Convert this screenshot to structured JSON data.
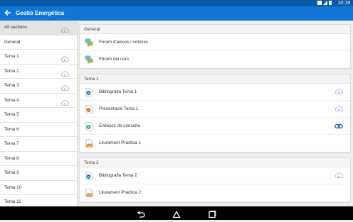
{
  "status": {
    "time": "10:19"
  },
  "header": {
    "title": "Gestió Energètica"
  },
  "sidebar": {
    "items": [
      {
        "label": "All sections",
        "cloud": true,
        "active": true
      },
      {
        "label": "General",
        "cloud": false
      },
      {
        "label": "Tema 1",
        "cloud": true
      },
      {
        "label": "Tema 2",
        "cloud": true
      },
      {
        "label": "Tema 3",
        "cloud": true
      },
      {
        "label": "Tema 4",
        "cloud": true
      },
      {
        "label": "Tema 5",
        "cloud": false
      },
      {
        "label": "Tema 6",
        "cloud": false
      },
      {
        "label": "Tema 7",
        "cloud": false
      },
      {
        "label": "Tema 8",
        "cloud": false
      },
      {
        "label": "Tema 9",
        "cloud": false
      },
      {
        "label": "Tema 10",
        "cloud": false
      },
      {
        "label": "Tema 11",
        "cloud": false
      }
    ]
  },
  "sections": [
    {
      "title": "General",
      "modules": [
        {
          "label": "Fòrum d'avisos i notícies",
          "icon": "forum-icon",
          "action": ""
        },
        {
          "label": "Fòrum del curs",
          "icon": "forum-icon",
          "action": ""
        }
      ]
    },
    {
      "title": "Tema 1",
      "modules": [
        {
          "label": "Bibliografia Tema 1",
          "icon": "word-document-icon",
          "action": "download"
        },
        {
          "label": "Presentació Tema 1",
          "icon": "pdf-document-icon",
          "action": "download"
        },
        {
          "label": "Enllaços de consulta",
          "icon": "url-icon",
          "action": "link"
        },
        {
          "label": "Lliurament Pràctica 1",
          "icon": "assignment-icon",
          "action": ""
        }
      ]
    },
    {
      "title": "Tema 2",
      "modules": [
        {
          "label": "Bibliografia Tema 2",
          "icon": "word-document-icon",
          "action": "download"
        },
        {
          "label": "Lliurament Pràctica 2",
          "icon": "assignment-icon",
          "action": ""
        }
      ]
    }
  ],
  "colors": {
    "appbar": "#1077d6",
    "statusbar": "#0a5aa8",
    "cloud": "#8fb3e0",
    "link": "#1d5fb8"
  }
}
